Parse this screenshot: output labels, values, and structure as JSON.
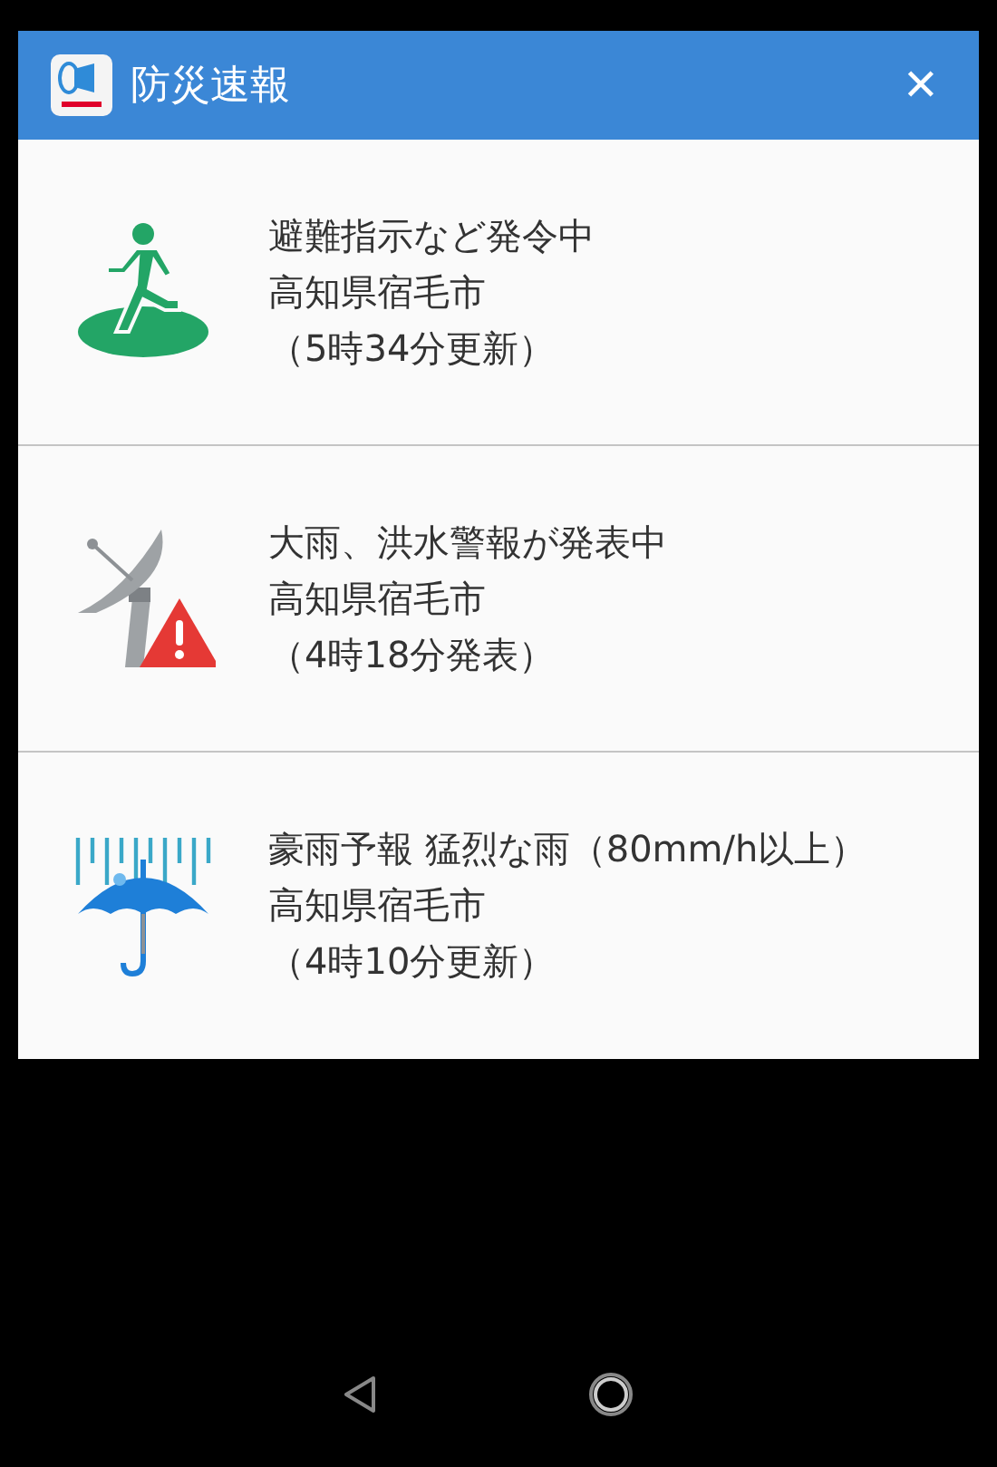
{
  "header": {
    "title": "防災速報",
    "close": "✕"
  },
  "alerts": [
    {
      "kind": "evacuation",
      "title": "避難指示など発令中",
      "place": "高知県宿毛市",
      "time": "（5時34分更新）"
    },
    {
      "kind": "warning",
      "title": "大雨、洪水警報が発表中",
      "place": "高知県宿毛市",
      "time": "（4時18分発表）"
    },
    {
      "kind": "rain",
      "title": "豪雨予報 猛烈な雨（80mm/h以上）",
      "place": "高知県宿毛市",
      "time": "（4時10分更新）"
    }
  ]
}
